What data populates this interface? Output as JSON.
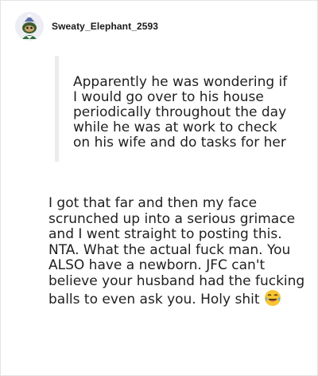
{
  "comment": {
    "username": "Sweaty_Elephant_2593",
    "avatar_icon": "snoo-avatar-icon",
    "quote": "Apparently he was wondering if I would go over to his house periodically throughout the day while he was at work to check on his wife and do tasks for her",
    "body": "I got that far and then my face scrunched up into a serious grimace and I went straight to posting this. NTA. What the actual fuck man. You ALSO have a newborn. JFC can't believe your husband had the fucking balls to even ask you. Holy shit",
    "emoji_icon": "tears-of-joy-emoji-icon"
  },
  "colors": {
    "quote_bar": "#ececec",
    "text": "#1f1f1f",
    "username": "#1a1a1b"
  }
}
